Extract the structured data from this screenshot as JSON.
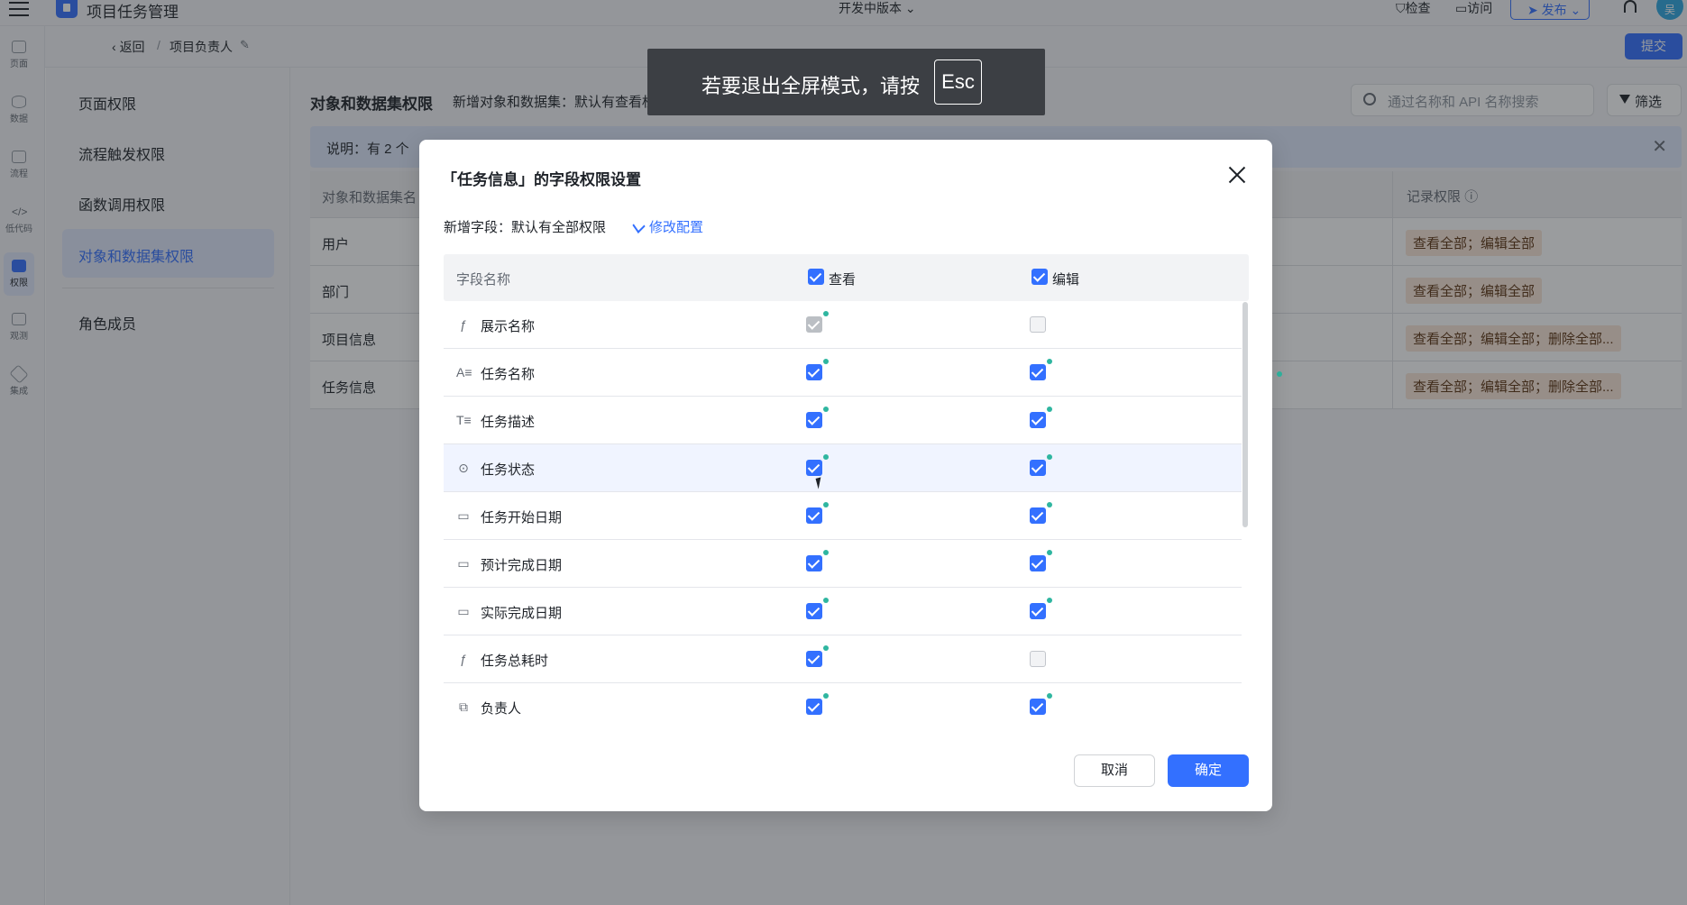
{
  "topbar": {
    "app_title": "项目任务管理",
    "version": "开发中版本",
    "check": "检查",
    "visit": "访问",
    "publish": "发布",
    "avatar": "吴"
  },
  "rail": [
    {
      "label": "页面",
      "icon": "page-icon"
    },
    {
      "label": "数据",
      "icon": "database-icon"
    },
    {
      "label": "流程",
      "icon": "flow-icon"
    },
    {
      "label": "低代码",
      "icon": "code-icon"
    },
    {
      "label": "权限",
      "icon": "lock-icon"
    },
    {
      "label": "观测",
      "icon": "observe-icon"
    },
    {
      "label": "集成",
      "icon": "integration-icon"
    }
  ],
  "breadcrumb": {
    "back": "返回",
    "sep": "/",
    "current": "项目负责人"
  },
  "submit": "提交",
  "leftnav": [
    "页面权限",
    "流程触发权限",
    "函数调用权限",
    "对象和数据集权限",
    "角色成员"
  ],
  "main": {
    "title": "对象和数据集权限",
    "subtitle": "新增对象和数据集：默认有查看权限",
    "search_placeholder": "通过名称和 API 名称搜索",
    "filter": "筛选",
    "notice": "说明：有 2 个",
    "col_name": "对象和数据集名",
    "col_record": "记录权限",
    "rows": [
      {
        "name": "用户",
        "record": "查看全部；编辑全部"
      },
      {
        "name": "部门",
        "record": "查看全部；编辑全部"
      },
      {
        "name": "项目信息",
        "record": "查看全部；编辑全部；删除全部..."
      },
      {
        "name": "任务信息",
        "record": "查看全部；编辑全部；删除全部..."
      }
    ]
  },
  "fullscreen_toast": {
    "text": "若要退出全屏模式，请按",
    "key": "Esc"
  },
  "dialog": {
    "title": "「任务信息」的字段权限设置",
    "new_field_text": "新增字段：默认有全部权限",
    "modify_config": "修改配置",
    "col_field": "字段名称",
    "col_view": "查看",
    "col_edit": "编辑",
    "fields": [
      {
        "name": "展示名称",
        "icon": "formula-icon",
        "view": "disabled-checked",
        "edit": "unchecked"
      },
      {
        "name": "任务名称",
        "icon": "text-icon",
        "view": "checked",
        "edit": "checked"
      },
      {
        "name": "任务描述",
        "icon": "multiline-text-icon",
        "view": "checked",
        "edit": "checked"
      },
      {
        "name": "任务状态",
        "icon": "option-icon",
        "view": "checked",
        "edit": "checked"
      },
      {
        "name": "任务开始日期",
        "icon": "calendar-icon",
        "view": "checked",
        "edit": "checked"
      },
      {
        "name": "预计完成日期",
        "icon": "calendar-icon",
        "view": "checked",
        "edit": "checked"
      },
      {
        "name": "实际完成日期",
        "icon": "calendar-icon",
        "view": "checked",
        "edit": "checked"
      },
      {
        "name": "任务总耗时",
        "icon": "formula-icon",
        "view": "checked",
        "edit": "unchecked"
      },
      {
        "name": "负责人",
        "icon": "lookup-icon",
        "view": "checked",
        "edit": "checked"
      }
    ],
    "cancel": "取消",
    "ok": "确定"
  }
}
